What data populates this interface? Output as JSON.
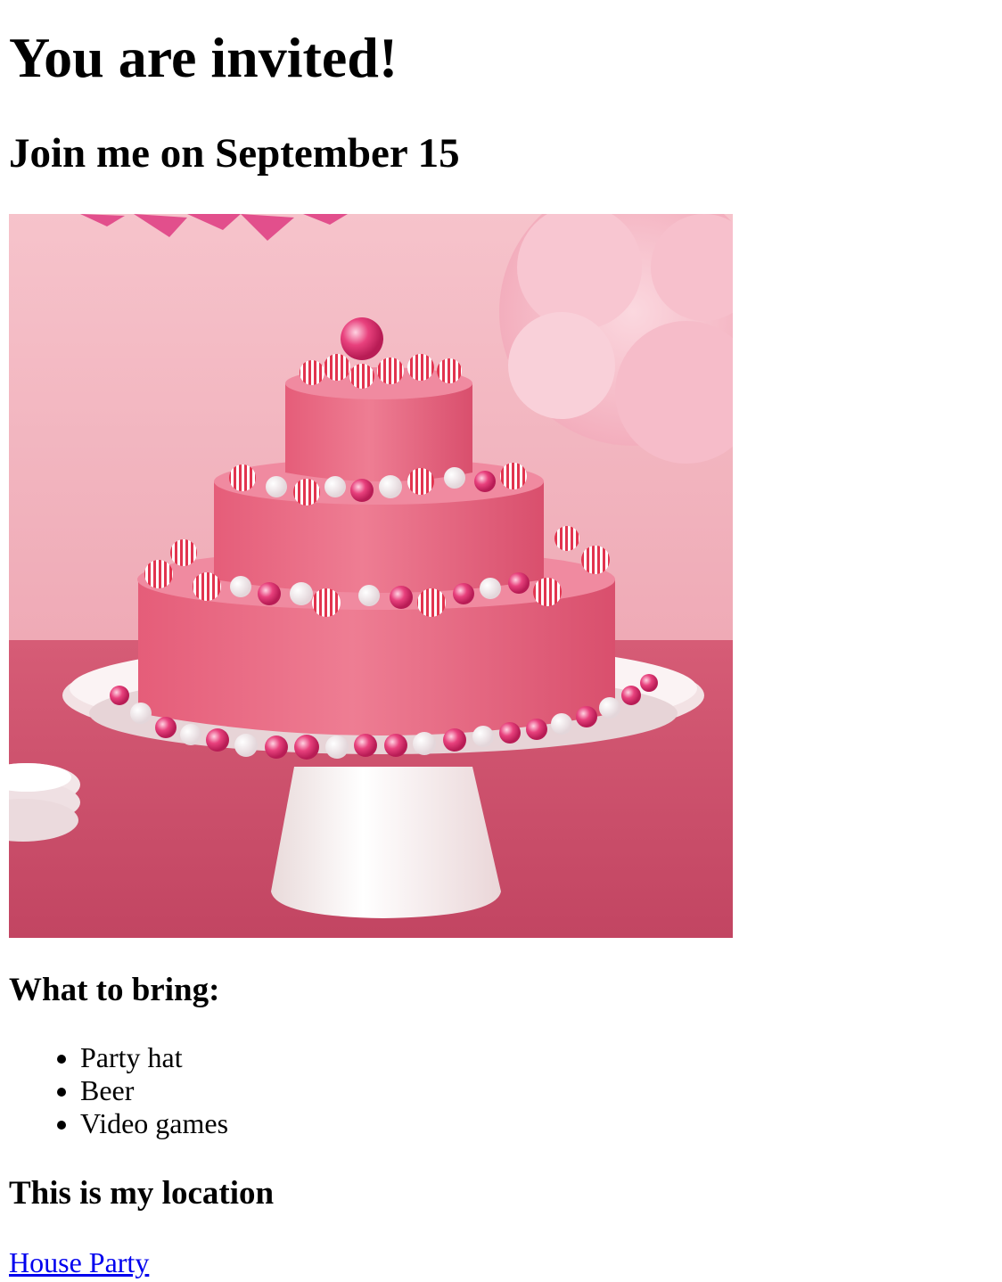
{
  "header": {
    "title": "You are invited!",
    "subtitle": "Join me on September 15"
  },
  "image": {
    "alt": "Pink three-tier birthday cake on a white cake stand",
    "colors": {
      "wall": "#f4b6c0",
      "table": "#d4566f",
      "frosting": "#e8667e",
      "stand": "#f7eeee",
      "candy_pink": "#e0306c"
    }
  },
  "bring": {
    "heading": "What to bring:",
    "items": [
      "Party hat",
      "Beer",
      "Video games"
    ]
  },
  "location": {
    "heading": "This is my location",
    "link_label": "House Party",
    "link_color": "#0000ee"
  }
}
